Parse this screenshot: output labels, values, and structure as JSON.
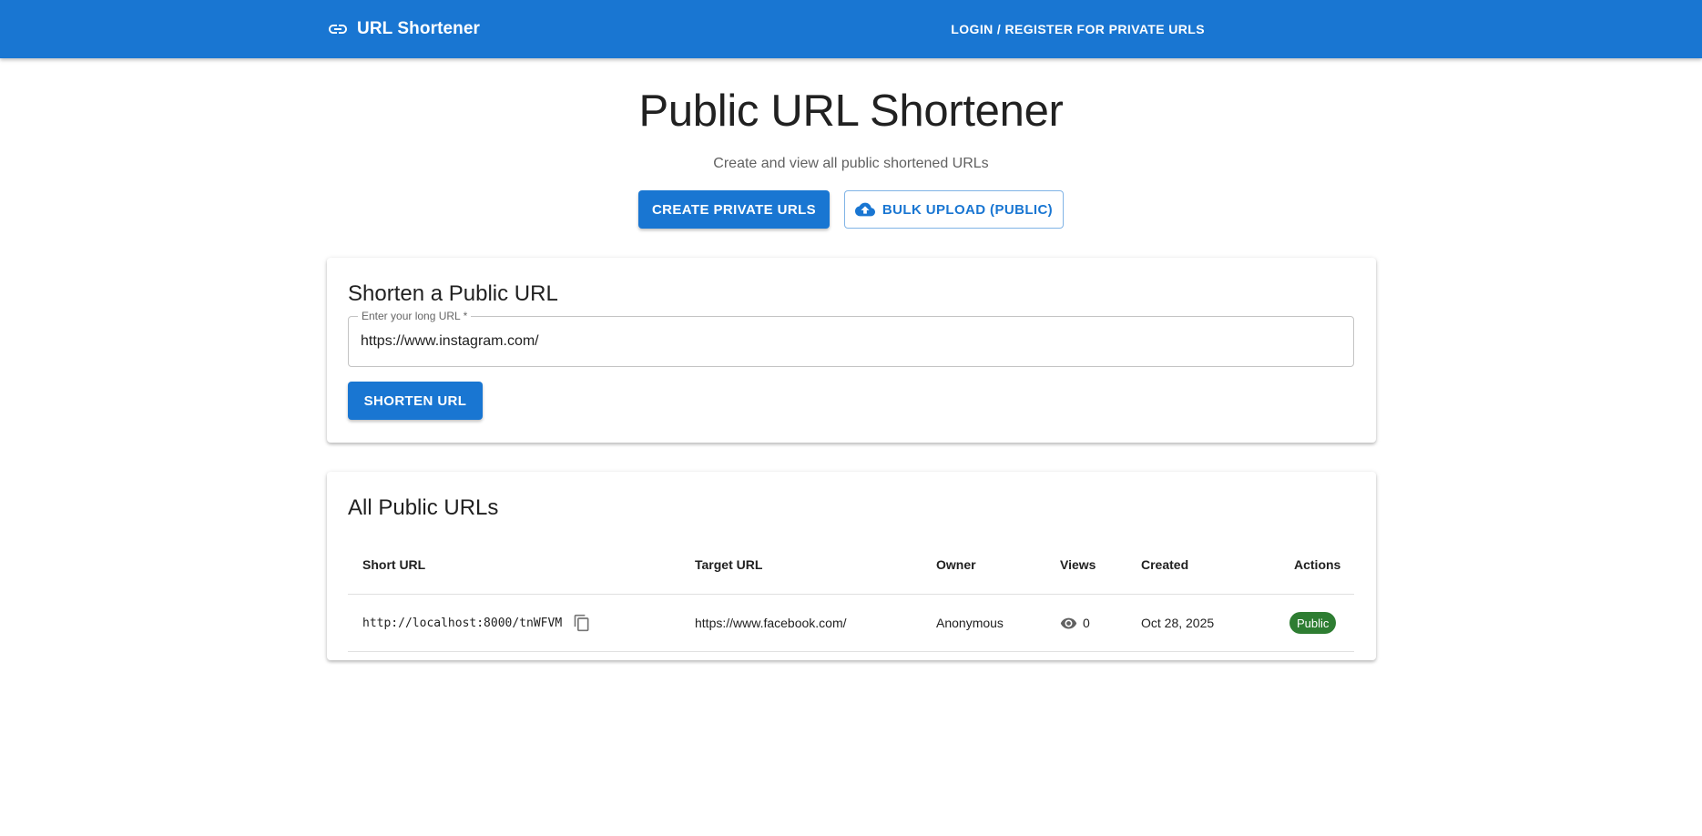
{
  "appbar": {
    "brand": "URL Shortener",
    "brand_icon": "link-icon",
    "login_label": "LOGIN / REGISTER FOR PRIVATE URLS",
    "color": "#1976d2"
  },
  "hero": {
    "title": "Public URL Shortener",
    "subtitle": "Create and view all public shortened URLs",
    "create_private_label": "CREATE PRIVATE URLS",
    "bulk_upload_label": "BULK UPLOAD (PUBLIC)",
    "bulk_upload_icon": "cloud-upload-icon"
  },
  "shorten_card": {
    "title": "Shorten a Public URL",
    "field_label": "Enter your long URL *",
    "field_value": "https://www.instagram.com/",
    "submit_label": "SHORTEN URL"
  },
  "urls_card": {
    "title": "All Public URLs",
    "columns": [
      "Short URL",
      "Target URL",
      "Owner",
      "Views",
      "Created",
      "Actions"
    ],
    "rows": [
      {
        "short_url": "http://localhost:8000/tnWFVM",
        "target_url": "https://www.facebook.com/",
        "owner": "Anonymous",
        "views": "0",
        "created": "Oct 28, 2025",
        "status": "Public"
      }
    ]
  },
  "colors": {
    "primary": "#1976d2",
    "public_chip": "#2e7d32"
  }
}
